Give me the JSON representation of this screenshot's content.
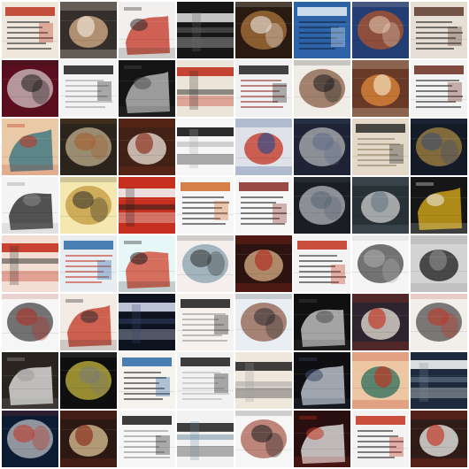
{
  "grid": {
    "rows": 8,
    "cols": 8,
    "background": "#ffffff",
    "tiles": [
      {
        "base": "#efe6dc",
        "accent": "#b8341f",
        "ink": "#1b1b1b",
        "style": "doc"
      },
      {
        "base": "#1f1a17",
        "accent": "#d8b28a",
        "ink": "#f1e7da",
        "style": "photo"
      },
      {
        "base": "#f2f0ee",
        "accent": "#c2311f",
        "ink": "#2a2a2a",
        "style": "splash"
      },
      {
        "base": "#161616",
        "accent": "#d8d8d8",
        "ink": "#6c6c6c",
        "style": "stripe"
      },
      {
        "base": "#2a1b12",
        "accent": "#c98a45",
        "ink": "#f2f2f2",
        "style": "blob"
      },
      {
        "base": "#2f63a8",
        "accent": "#e8eef6",
        "ink": "#11243f",
        "style": "doc"
      },
      {
        "base": "#233e73",
        "accent": "#d45a1a",
        "ink": "#e9d0b5",
        "style": "blob"
      },
      {
        "base": "#e7ded6",
        "accent": "#5c3b2a",
        "ink": "#131313",
        "style": "doc"
      },
      {
        "base": "#5b0f1e",
        "accent": "#f0f0f0",
        "ink": "#1a1a1a",
        "style": "blob"
      },
      {
        "base": "#f3f3f3",
        "accent": "#1d1d1d",
        "ink": "#9b9b9b",
        "style": "doc"
      },
      {
        "base": "#141414",
        "accent": "#c8c8c8",
        "ink": "#4e4e4e",
        "style": "splash"
      },
      {
        "base": "#ece4d8",
        "accent": "#c1311f",
        "ink": "#2a2a2a",
        "style": "stripe"
      },
      {
        "base": "#f1f1f1",
        "accent": "#222222",
        "ink": "#8b2a24",
        "style": "doc"
      },
      {
        "base": "#f0ece6",
        "accent": "#6a3a1d",
        "ink": "#1a1a1a",
        "style": "blob"
      },
      {
        "base": "#5a2616",
        "accent": "#e08a3a",
        "ink": "#f5e4c8",
        "style": "photo"
      },
      {
        "base": "#f3f3f3",
        "accent": "#6a2b1f",
        "ink": "#1a1a1a",
        "style": "doc"
      },
      {
        "base": "#e9c9a6",
        "accent": "#2c6d7e",
        "ink": "#c2311f",
        "style": "splash"
      },
      {
        "base": "#2b241c",
        "accent": "#e2d2a8",
        "ink": "#a55a2a",
        "style": "blob"
      },
      {
        "base": "#3a2216",
        "accent": "#f0e6dc",
        "ink": "#8b2b1a",
        "style": "photo"
      },
      {
        "base": "#f6f6f6",
        "accent": "#161616",
        "ink": "#a8a8a8",
        "style": "stripe"
      },
      {
        "base": "#f2f2f2",
        "accent": "#c2311f",
        "ink": "#2d4a8a",
        "style": "photo"
      },
      {
        "base": "#1e2436",
        "accent": "#d7d7d7",
        "ink": "#5b6a8a",
        "style": "blob"
      },
      {
        "base": "#e4d9c8",
        "accent": "#2a2a2a",
        "ink": "#8a7a5a",
        "style": "doc"
      },
      {
        "base": "#151a27",
        "accent": "#c9a14a",
        "ink": "#3a4a74",
        "style": "blob"
      },
      {
        "base": "#f4f4f4",
        "accent": "#1b1b1b",
        "ink": "#8a8a8a",
        "style": "splash"
      },
      {
        "base": "#f4e7b0",
        "accent": "#b5851d",
        "ink": "#2a2a2a",
        "style": "blob"
      },
      {
        "base": "#c7301e",
        "accent": "#f1f1f1",
        "ink": "#1a1a1a",
        "style": "stripe"
      },
      {
        "base": "#f7f7f7",
        "accent": "#d06b2a",
        "ink": "#1a1a1a",
        "style": "doc"
      },
      {
        "base": "#f6f6f6",
        "accent": "#8a2b24",
        "ink": "#1a1a1a",
        "style": "doc"
      },
      {
        "base": "#1a1d21",
        "accent": "#d8dde4",
        "ink": "#566373",
        "style": "blob"
      },
      {
        "base": "#202a2e",
        "accent": "#cfcfcf",
        "ink": "#6a7a84",
        "style": "photo"
      },
      {
        "base": "#161616",
        "accent": "#e1b11a",
        "ink": "#f1f1f1",
        "style": "splash"
      },
      {
        "base": "#f2ded2",
        "accent": "#c2311f",
        "ink": "#2a2a2a",
        "style": "stripe"
      },
      {
        "base": "#e8edf1",
        "accent": "#2b6aa7",
        "ink": "#c2311f",
        "style": "doc"
      },
      {
        "base": "#e7f6f6",
        "accent": "#d0402a",
        "ink": "#1a1a1a",
        "style": "splash"
      },
      {
        "base": "#f4efec",
        "accent": "#6a8ea0",
        "ink": "#2a2a2a",
        "style": "blob"
      },
      {
        "base": "#1e110e",
        "accent": "#d8b28a",
        "ink": "#b02a1d",
        "style": "photo"
      },
      {
        "base": "#f4f4f4",
        "accent": "#c2311f",
        "ink": "#1a1a1a",
        "style": "doc"
      },
      {
        "base": "#f5f5f5",
        "accent": "#1b1b1b",
        "ink": "#b2b2b2",
        "style": "blob"
      },
      {
        "base": "#dcdcdc",
        "accent": "#1a1a1a",
        "ink": "#8a8a8a",
        "style": "photo"
      },
      {
        "base": "#f6f6f6",
        "accent": "#1a1a1a",
        "ink": "#b32a1f",
        "style": "blob"
      },
      {
        "base": "#f2ece4",
        "accent": "#c2311f",
        "ink": "#2a2a2a",
        "style": "splash"
      },
      {
        "base": "#0e1320",
        "accent": "#cfd7ea",
        "ink": "#36466e",
        "style": "stripe"
      },
      {
        "base": "#f5f2ef",
        "accent": "#1b1b1b",
        "ink": "#8f8f8f",
        "style": "doc"
      },
      {
        "base": "#e8eef4",
        "accent": "#7a3a1f",
        "ink": "#2a2a2a",
        "style": "blob"
      },
      {
        "base": "#101010",
        "accent": "#d5d5d5",
        "ink": "#4b4b4b",
        "style": "splash"
      },
      {
        "base": "#1b2330",
        "accent": "#e9e3d8",
        "ink": "#c2311f",
        "style": "photo"
      },
      {
        "base": "#f2eee9",
        "accent": "#2a2a2a",
        "ink": "#c2311f",
        "style": "blob"
      },
      {
        "base": "#2a241f",
        "accent": "#f0f0f0",
        "ink": "#9a9a9a",
        "style": "splash"
      },
      {
        "base": "#0f0f0f",
        "accent": "#f2e04a",
        "ink": "#7a7a7a",
        "style": "blob"
      },
      {
        "base": "#f6f2ee",
        "accent": "#2a6aa7",
        "ink": "#1b1b1b",
        "style": "doc"
      },
      {
        "base": "#f2f2f2",
        "accent": "#1b1b1b",
        "ink": "#b2b2b2",
        "style": "doc"
      },
      {
        "base": "#efe6dc",
        "accent": "#2a2a2a",
        "ink": "#9a9a9a",
        "style": "stripe"
      },
      {
        "base": "#0f0f12",
        "accent": "#d2d9e6",
        "ink": "#3a4866",
        "style": "splash"
      },
      {
        "base": "#f2d8b4",
        "accent": "#2a6d5e",
        "ink": "#c2311f",
        "style": "photo"
      },
      {
        "base": "#1e2a3b",
        "accent": "#f0f0f0",
        "ink": "#7a8aa0",
        "style": "stripe"
      },
      {
        "base": "#0d1b33",
        "accent": "#e8e8e8",
        "ink": "#c2311f",
        "style": "blob"
      },
      {
        "base": "#221812",
        "accent": "#e0c59a",
        "ink": "#8b2b1a",
        "style": "photo"
      },
      {
        "base": "#f6f6f6",
        "accent": "#1b1b1b",
        "ink": "#8a8a8a",
        "style": "doc"
      },
      {
        "base": "#f2f2f2",
        "accent": "#2a2a2a",
        "ink": "#6a8aa0",
        "style": "stripe"
      },
      {
        "base": "#f6f6f6",
        "accent": "#9a3a2a",
        "ink": "#1a1a1a",
        "style": "blob"
      },
      {
        "base": "#2a0f10",
        "accent": "#f2f2f2",
        "ink": "#c2311f",
        "style": "splash"
      },
      {
        "base": "#f3f3f3",
        "accent": "#c2311f",
        "ink": "#1a1a1a",
        "style": "doc"
      },
      {
        "base": "#1f1a17",
        "accent": "#f2f2f2",
        "ink": "#c2311f",
        "style": "photo"
      }
    ]
  }
}
